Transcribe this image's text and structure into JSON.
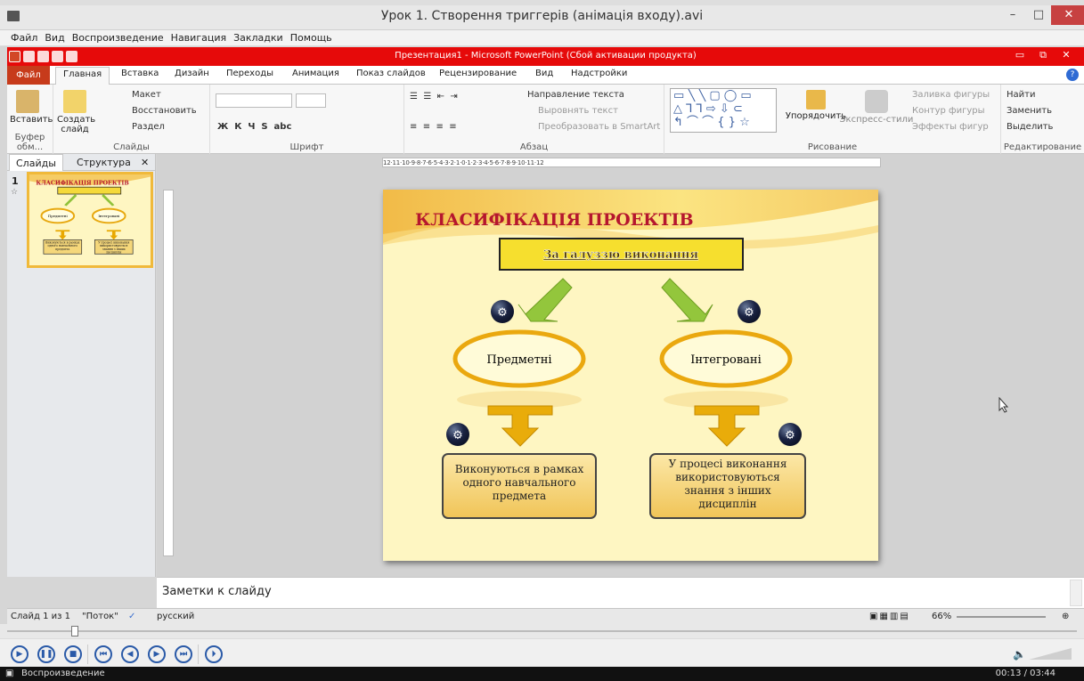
{
  "player": {
    "window_title": "Урок 1. Створення триггерів (анімація входу).avi",
    "menu": [
      "Файл",
      "Вид",
      "Воспроизведение",
      "Навигация",
      "Закладки",
      "Помощь"
    ],
    "status_text": "Воспроизведение",
    "time": "00:13 / 03:44",
    "seek_fraction": 0.06
  },
  "ppt": {
    "title": "Презентация1 - Microsoft PowerPoint (Сбой активации продукта)",
    "tabs": [
      "Файл",
      "Главная",
      "Вставка",
      "Дизайн",
      "Переходы",
      "Анимация",
      "Показ слайдов",
      "Рецензирование",
      "Вид",
      "Надстройки"
    ],
    "active_tab": "Главная",
    "ribbon": {
      "clipboard": {
        "paste": "Вставить",
        "group": "Буфер обм..."
      },
      "slides": {
        "new_slide": "Создать слайд",
        "layout": "Макет",
        "reset": "Восстановить",
        "section": "Раздел",
        "group": "Слайды"
      },
      "font": {
        "group": "Шрифт"
      },
      "paragraph": {
        "text_dir": "Направление текста",
        "align_text": "Выровнять текст",
        "smartart": "Преобразовать в SmartArt",
        "group": "Абзац"
      },
      "drawing": {
        "arrange": "Упорядочить",
        "quick_styles": "Экспресс-стили",
        "fill": "Заливка фигуры",
        "outline": "Контур фигуры",
        "effects": "Эффекты фигур",
        "group": "Рисование"
      },
      "editing": {
        "find": "Найти",
        "replace": "Заменить",
        "select": "Выделить",
        "group": "Редактирование"
      }
    },
    "left_tabs": [
      "Слайды",
      "Структура"
    ],
    "slide_number": "1",
    "notes_placeholder": "Заметки к слайду",
    "status": {
      "slide": "Слайд 1 из 1",
      "theme": "\"Поток\"",
      "lang": "русский",
      "zoom": "66%"
    },
    "ruler_h": "12·11·10·9·8·7·6·5·4·3·2·1·0·1·2·3·4·5·6·7·8·9·10·11·12"
  },
  "slide": {
    "title": "КЛАСИФІКАЦІЯ ПРОЕКТІВ",
    "header_box": "За галуззю виконання",
    "left_oval": "Предметні",
    "right_oval": "Інтегровані",
    "left_box": "Виконуються в рамках одного навчального предмета",
    "right_box": "У процесі виконання використовуються знання з інших дисциплін"
  },
  "thumbnail": {
    "title": "КЛАСИФІКАЦІЯ ПРОЕКТІВ",
    "left_oval": "Предметні",
    "right_oval": "Інтегровані",
    "left_box": "Виконуються в рамках одного навчального предмета",
    "right_box": "У процесі виконання використовуються знання з інших дисциплін"
  },
  "colors": {
    "ppt_red": "#e60a0a",
    "file_tab": "#c73b1b",
    "slide_bg": "#fef6c2",
    "title_red": "#b5162e",
    "gold": "#f0b93a"
  }
}
